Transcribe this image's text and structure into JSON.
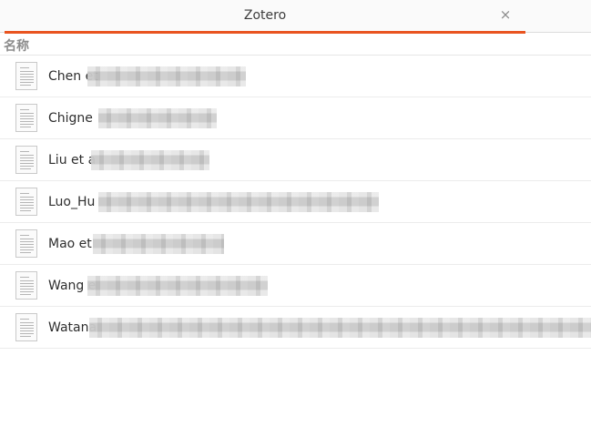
{
  "tab": {
    "title": "Zotero",
    "close_glyph": "×",
    "accent": "#e95420"
  },
  "column_header": {
    "name_label": "名称"
  },
  "files": [
    {
      "name": "Chen et",
      "icon": "pdf-document-icon"
    },
    {
      "name": "Chigne",
      "icon": "pdf-document-icon"
    },
    {
      "name": "Liu et a",
      "icon": "pdf-document-icon"
    },
    {
      "name": "Luo_Hu",
      "icon": "pdf-document-icon"
    },
    {
      "name": "Mao et",
      "icon": "pdf-document-icon"
    },
    {
      "name": "Wang e",
      "icon": "pdf-document-icon"
    },
    {
      "name": "Watana",
      "icon": "pdf-document-icon"
    }
  ]
}
